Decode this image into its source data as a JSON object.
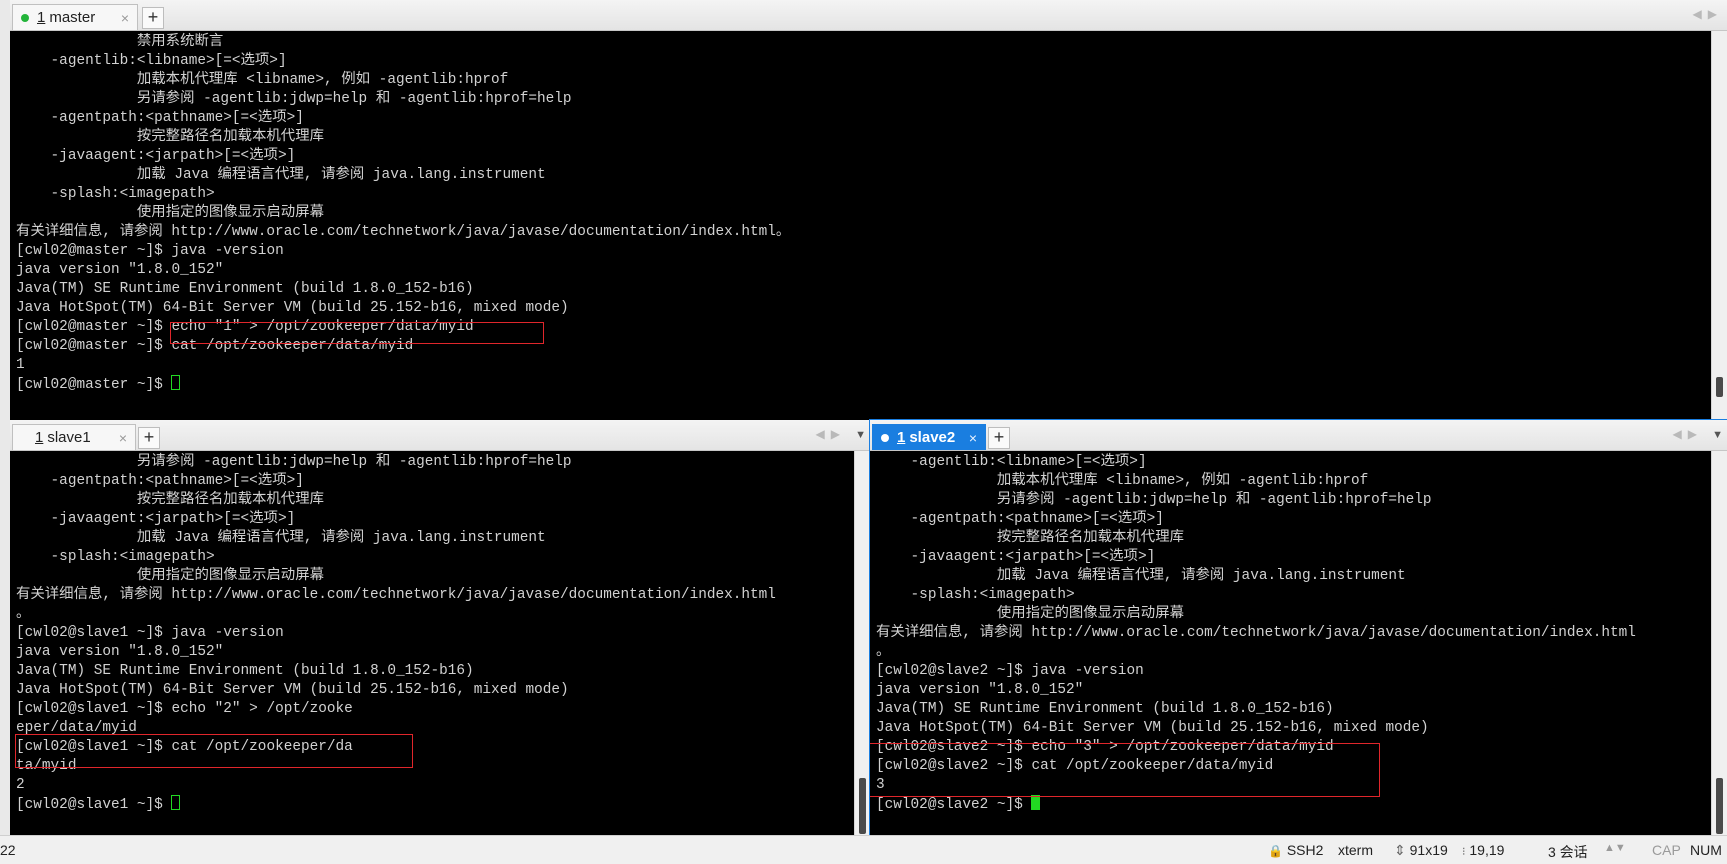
{
  "master": {
    "tab": {
      "num": "1",
      "label": "master",
      "close": "×"
    },
    "add_tab": "+",
    "lines": [
      "              禁用系统断言",
      "    -agentlib:<libname>[=<选项>]",
      "              加载本机代理库 <libname>, 例如 -agentlib:hprof",
      "              另请参阅 -agentlib:jdwp=help 和 -agentlib:hprof=help",
      "    -agentpath:<pathname>[=<选项>]",
      "              按完整路径名加载本机代理库",
      "    -javaagent:<jarpath>[=<选项>]",
      "              加载 Java 编程语言代理, 请参阅 java.lang.instrument",
      "    -splash:<imagepath>",
      "              使用指定的图像显示启动屏幕",
      "有关详细信息, 请参阅 http://www.oracle.com/technetwork/java/javase/documentation/index.html。",
      "[cwl02@master ~]$ java -version",
      "java version \"1.8.0_152\"",
      "Java(TM) SE Runtime Environment (build 1.8.0_152-b16)",
      "Java HotSpot(TM) 64-Bit Server VM (build 25.152-b16, mixed mode)",
      "[cwl02@master ~]$ echo \"1\" > /opt/zookeeper/data/myid",
      "[cwl02@master ~]$ cat /opt/zookeeper/data/myid",
      "1"
    ],
    "prompt": "[cwl02@master ~]$ "
  },
  "slave1": {
    "tab": {
      "num": "1",
      "label": "slave1",
      "close": "×"
    },
    "add_tab": "+",
    "lines": [
      "              另请参阅 -agentlib:jdwp=help 和 -agentlib:hprof=help",
      "    -agentpath:<pathname>[=<选项>]",
      "              按完整路径名加载本机代理库",
      "    -javaagent:<jarpath>[=<选项>]",
      "              加载 Java 编程语言代理, 请参阅 java.lang.instrument",
      "    -splash:<imagepath>",
      "              使用指定的图像显示启动屏幕",
      "有关详细信息, 请参阅 http://www.oracle.com/technetwork/java/javase/documentation/index.html",
      "。",
      "[cwl02@slave1 ~]$ java -version",
      "java version \"1.8.0_152\"",
      "Java(TM) SE Runtime Environment (build 1.8.0_152-b16)",
      "Java HotSpot(TM) 64-Bit Server VM (build 25.152-b16, mixed mode)",
      "[cwl02@slave1 ~]$ echo \"2\" > /opt/zooke",
      "eper/data/myid",
      "[cwl02@slave1 ~]$ cat /opt/zookeeper/da",
      "ta/myid",
      "2"
    ],
    "prompt": "[cwl02@slave1 ~]$ "
  },
  "slave2": {
    "tab": {
      "num": "1",
      "label": "slave2",
      "close": "×"
    },
    "add_tab": "+",
    "lines": [
      "    -agentlib:<libname>[=<选项>]",
      "              加载本机代理库 <libname>, 例如 -agentlib:hprof",
      "              另请参阅 -agentlib:jdwp=help 和 -agentlib:hprof=help",
      "    -agentpath:<pathname>[=<选项>]",
      "              按完整路径名加载本机代理库",
      "    -javaagent:<jarpath>[=<选项>]",
      "              加载 Java 编程语言代理, 请参阅 java.lang.instrument",
      "    -splash:<imagepath>",
      "              使用指定的图像显示启动屏幕",
      "有关详细信息, 请参阅 http://www.oracle.com/technetwork/java/javase/documentation/index.html",
      "。",
      "[cwl02@slave2 ~]$ java -version",
      "java version \"1.8.0_152\"",
      "Java(TM) SE Runtime Environment (build 1.8.0_152-b16)",
      "Java HotSpot(TM) 64-Bit Server VM (build 25.152-b16, mixed mode)",
      "[cwl02@slave2 ~]$ echo \"3\" > /opt/zookeeper/data/myid",
      "[cwl02@slave2 ~]$ cat /opt/zookeeper/data/myid",
      "3"
    ],
    "prompt": "[cwl02@slave2 ~]$ "
  },
  "statusbar": {
    "left": "22",
    "protocol": "SSH2",
    "term_type": "xterm",
    "size": "91x19",
    "cursor_pos": "19,19",
    "sessions": "3 会话",
    "cap": "CAP",
    "num": "NUM"
  },
  "colors": {
    "accent": "#1a7ee0",
    "highlight_box": "#e0262b",
    "cursor": "#22d822"
  }
}
